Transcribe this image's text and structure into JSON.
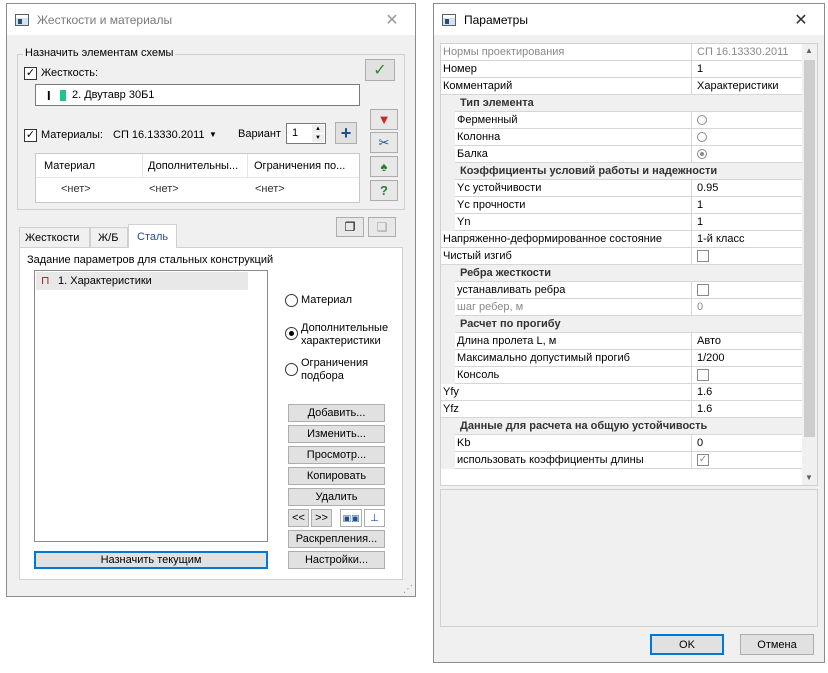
{
  "left_window": {
    "title": "Жесткости и материалы",
    "group_label": "Назначить элементам схемы",
    "stiffness_label": "Жесткость:",
    "stiffness_value": "2. Двутавр 30Б1",
    "materials_label": "Материалы:",
    "materials_norm": "СП 16.13330.2011",
    "variant_label": "Вариант",
    "variant_value": "1",
    "table_headers": [
      "Материал",
      "Дополнительны...",
      "Ограничения по..."
    ],
    "table_row": [
      "<нет>",
      "<нет>",
      "<нет>"
    ],
    "tabs": [
      "Жесткости",
      "Ж/Б",
      "Сталь"
    ],
    "steel_panel_label": "Задание параметров для стальных конструкций",
    "list_items": [
      "1. Характеристики"
    ],
    "radio_options": [
      "Материал",
      "Дополнительные характеристики",
      "Ограничения подбора"
    ],
    "radio_selected": 1,
    "buttons": {
      "add": "Добавить...",
      "edit": "Изменить...",
      "view": "Просмотр...",
      "copy": "Копировать",
      "delete": "Удалить",
      "prev": "<<",
      "next": ">>",
      "fastenings": "Раскрепления...",
      "settings": "Настройки...",
      "assign_current": "Назначить текущим"
    }
  },
  "right_window": {
    "title": "Параметры",
    "rows": [
      {
        "type": "prop",
        "name": "Нормы проектирования",
        "value": "СП 16.13330.2011",
        "disabled": true
      },
      {
        "type": "prop",
        "name": "Номер",
        "value": "1"
      },
      {
        "type": "prop",
        "name": "Комментарий",
        "value": "Характеристики"
      },
      {
        "type": "cat",
        "name": "Тип элемента"
      },
      {
        "type": "sub",
        "name": "Ферменный",
        "control": "radio",
        "checked": false
      },
      {
        "type": "sub",
        "name": "Колонна",
        "control": "radio",
        "checked": false
      },
      {
        "type": "sub",
        "name": "Балка",
        "control": "radio",
        "checked": true
      },
      {
        "type": "cat",
        "name": "Коэффициенты условий работы и надежности"
      },
      {
        "type": "sub",
        "name": "Yc устойчивости",
        "value": "0.95"
      },
      {
        "type": "sub",
        "name": "Yc прочности",
        "value": "1"
      },
      {
        "type": "sub",
        "name": "Yn",
        "value": "1"
      },
      {
        "type": "prop",
        "name": "Напряженно-деформированное состояние",
        "value": "1-й класс"
      },
      {
        "type": "prop",
        "name": "Чистый изгиб",
        "control": "check",
        "checked": false
      },
      {
        "type": "cat",
        "name": "Ребра жесткости"
      },
      {
        "type": "sub",
        "name": "устанавливать ребра",
        "control": "check",
        "checked": false
      },
      {
        "type": "sub",
        "name": "шаг ребер, м",
        "value": "0",
        "disabled": true
      },
      {
        "type": "cat",
        "name": "Расчет по прогибу"
      },
      {
        "type": "sub",
        "name": "Длина пролета L, м",
        "value": "Авто"
      },
      {
        "type": "sub",
        "name": "Максимально допустимый прогиб",
        "value": "1/200"
      },
      {
        "type": "sub",
        "name": "Консоль",
        "control": "check",
        "checked": false
      },
      {
        "type": "prop",
        "name": "Yfy",
        "value": "1.6"
      },
      {
        "type": "prop",
        "name": "Yfz",
        "value": "1.6"
      },
      {
        "type": "cat",
        "name": "Данные для расчета на общую устойчивость"
      },
      {
        "type": "sub",
        "name": "Kb",
        "value": "0"
      },
      {
        "type": "sub",
        "name": "использовать коэффициенты длины",
        "control": "check",
        "checked": true
      }
    ],
    "ok_label": "OK",
    "cancel_label": "Отмена"
  }
}
